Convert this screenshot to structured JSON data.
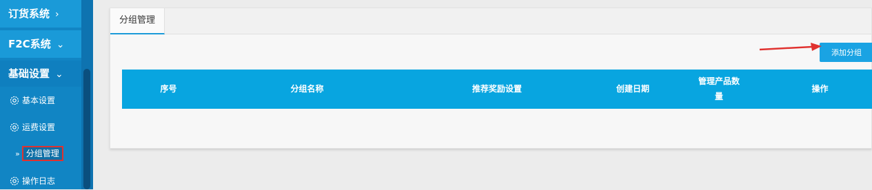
{
  "sidebar": {
    "sections": [
      {
        "label": "订货系统",
        "chevron": "›"
      },
      {
        "label": "F2C系统",
        "chevron": "⌄"
      },
      {
        "label": "基础设置",
        "chevron": "⌄"
      }
    ],
    "items": [
      {
        "label": "基本设置",
        "icon": "gear-icon"
      },
      {
        "label": "运费设置",
        "icon": "gear-icon"
      },
      {
        "label": "分组管理",
        "icon": "double-arrow-icon",
        "active": true
      },
      {
        "label": "操作日志",
        "icon": "gear-icon"
      }
    ]
  },
  "tabs": [
    {
      "label": "分组管理"
    }
  ],
  "toolbar": {
    "add_label": "添加分组"
  },
  "table": {
    "columns": [
      "序号",
      "分组名称",
      "推荐奖励设置",
      "创建日期",
      "管理产品数量",
      "操作"
    ],
    "column_wrapped": {
      "line1": "管理产品数",
      "line2": "量"
    },
    "rows": []
  },
  "colors": {
    "sidebar": "#1185c4",
    "header_blue": "#08a5e0",
    "button_blue": "#1aa3e3",
    "highlight_red": "#e0322f"
  }
}
